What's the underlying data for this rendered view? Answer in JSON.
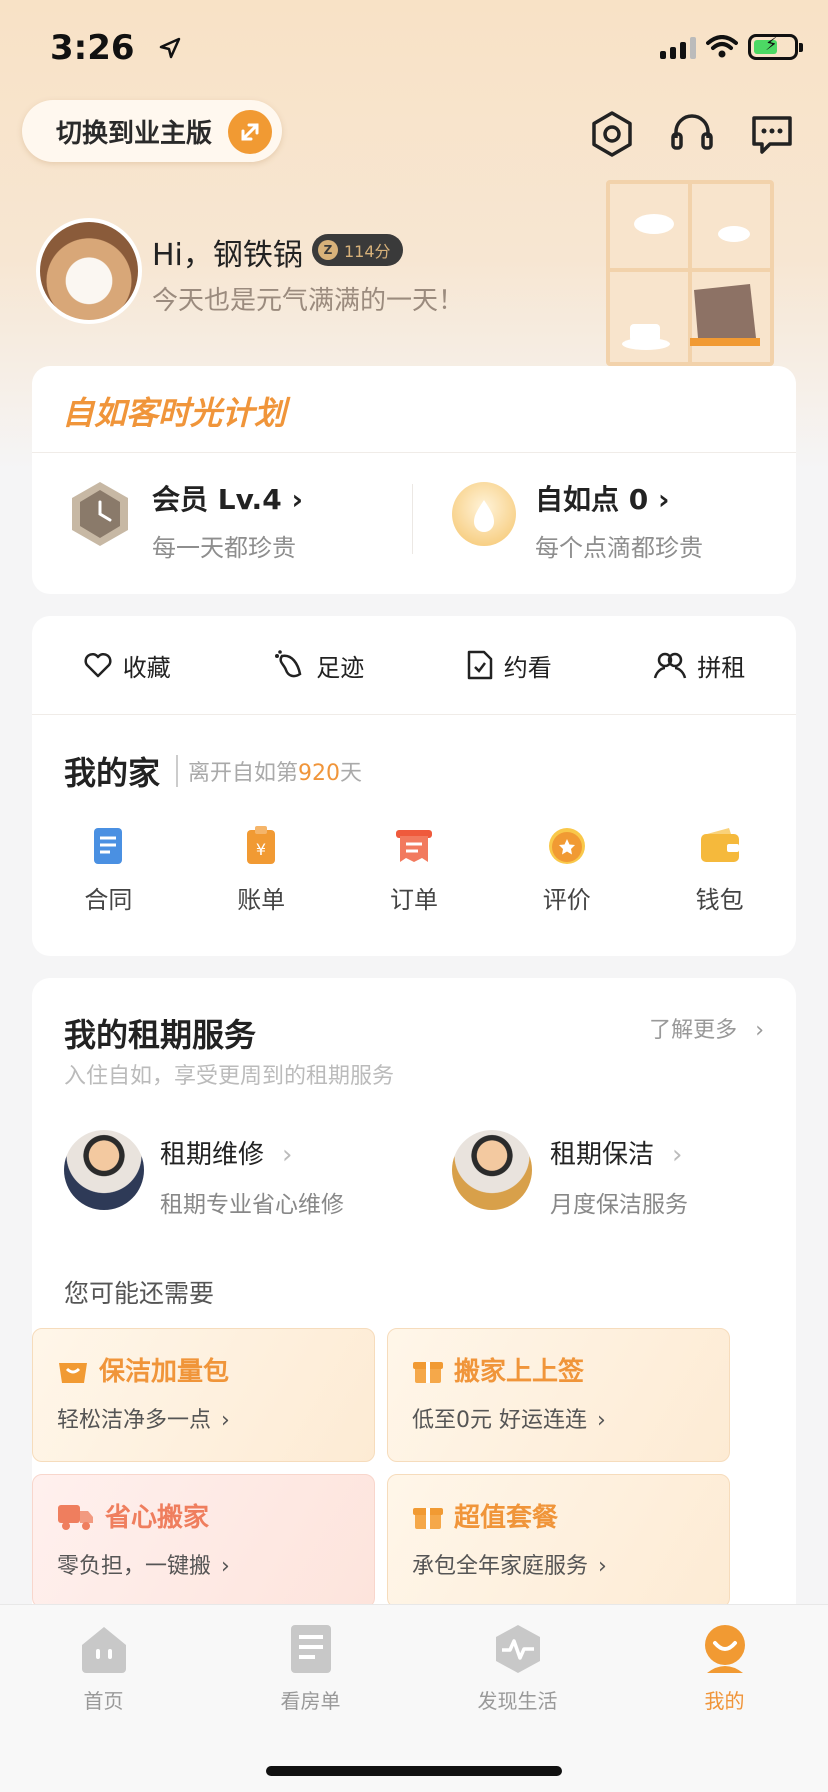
{
  "status": {
    "time": "3:26"
  },
  "header": {
    "switch_label": "切换到业主版"
  },
  "profile": {
    "greeting": "Hi，钢铁锅",
    "points": "114分",
    "subtitle": "今天也是元气满满的一天！"
  },
  "plan": {
    "title": "自如客时光计划",
    "member_label": "会员 Lv.4",
    "member_sub": "每一天都珍贵",
    "points_label": "自如点 0",
    "points_sub": "每个点滴都珍贵"
  },
  "quick": [
    {
      "label": "收藏",
      "icon": "heart-icon"
    },
    {
      "label": "足迹",
      "icon": "footprint-icon"
    },
    {
      "label": "约看",
      "icon": "appointment-icon"
    },
    {
      "label": "拼租",
      "icon": "people-icon"
    }
  ],
  "home": {
    "title": "我的家",
    "days_prefix": "离开自如第",
    "days": "920",
    "days_suffix": "天",
    "items": [
      {
        "label": "合同",
        "icon": "contract-icon",
        "color": "#4a90e2"
      },
      {
        "label": "账单",
        "icon": "bill-icon",
        "color": "#f19a33"
      },
      {
        "label": "订单",
        "icon": "order-icon",
        "color": "#ef5a3c"
      },
      {
        "label": "评价",
        "icon": "rating-icon",
        "color": "#f19a33"
      },
      {
        "label": "钱包",
        "icon": "wallet-icon",
        "color": "#f5b93c"
      }
    ]
  },
  "service": {
    "title": "我的租期服务",
    "more": "了解更多",
    "subtitle": "入住自如，享受更周到的租期服务",
    "repair_title": "租期维修",
    "repair_sub": "租期专业省心维修",
    "clean_title": "租期保洁",
    "clean_sub": "月度保洁服务",
    "maybe_title": "您可能还需要",
    "tiles": [
      {
        "title": "保洁加量包",
        "desc": "轻松洁净多一点",
        "icon": "basket-icon"
      },
      {
        "title": "搬家上上签",
        "desc": "低至0元  好运连连",
        "icon": "gift-icon"
      },
      {
        "title": "省心搬家",
        "desc": "零负担，一键搬",
        "icon": "truck-icon"
      },
      {
        "title": "超值套餐",
        "desc": "承包全年家庭服务",
        "icon": "gift-icon"
      }
    ]
  },
  "tabs": [
    {
      "label": "首页",
      "icon": "home-icon"
    },
    {
      "label": "看房单",
      "icon": "list-icon"
    },
    {
      "label": "发现生活",
      "icon": "discover-icon"
    },
    {
      "label": "我的",
      "icon": "profile-icon"
    }
  ],
  "colors": {
    "accent": "#f0953a",
    "background": "#f5f5f6"
  }
}
